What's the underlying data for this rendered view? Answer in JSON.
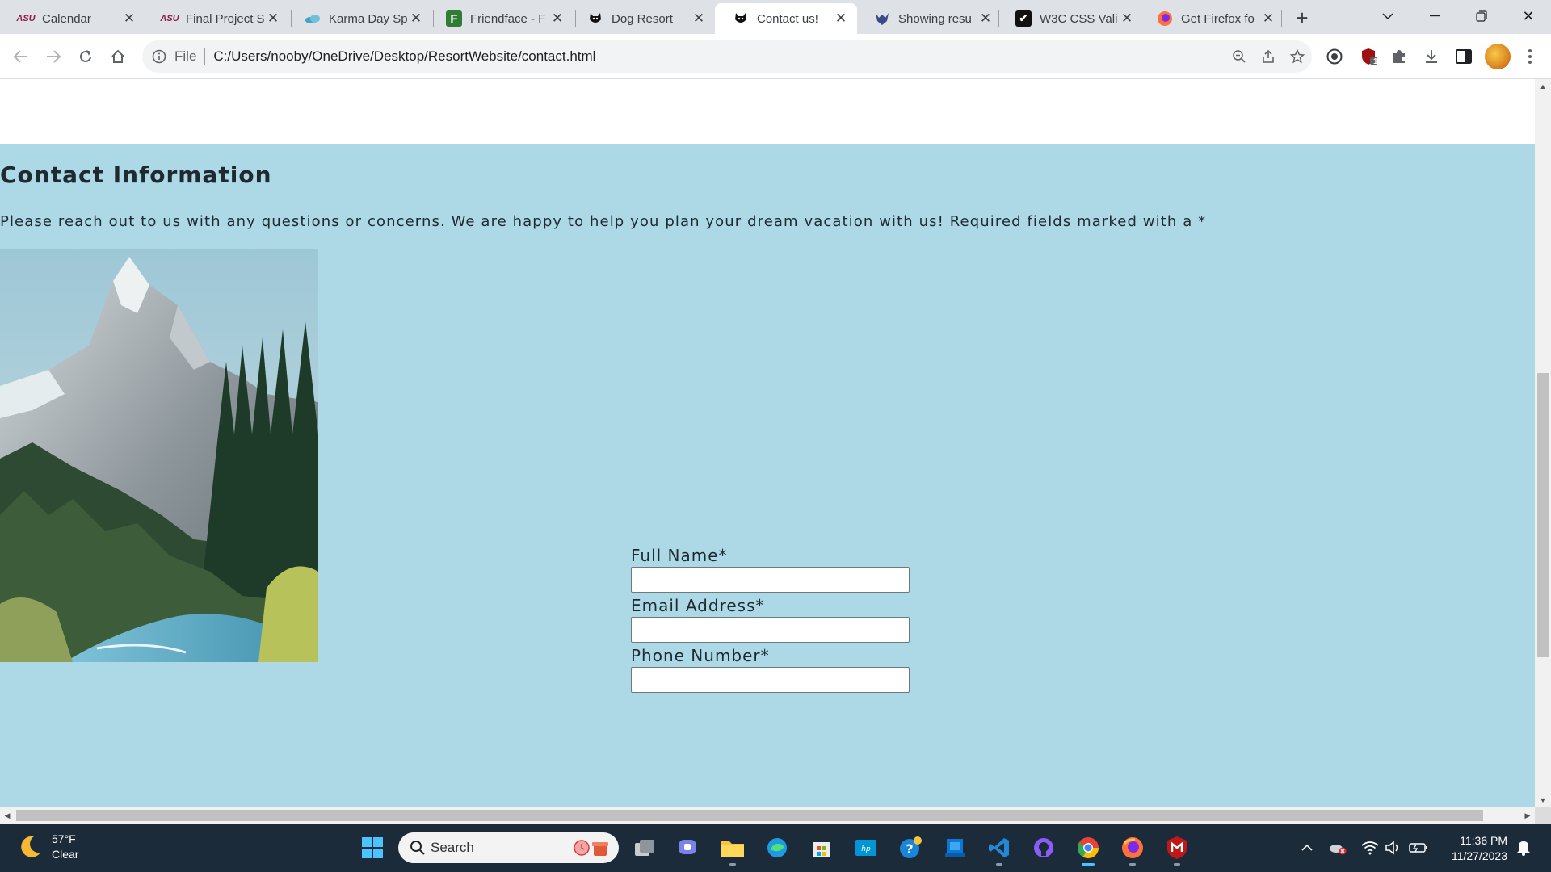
{
  "browser": {
    "tabs": [
      {
        "title": "Calendar",
        "favicon": "asu-logo-icon",
        "active": false
      },
      {
        "title": "Final Project S",
        "favicon": "asu-logo-icon",
        "active": false
      },
      {
        "title": "Karma Day Sp",
        "favicon": "cloud-icon",
        "active": false
      },
      {
        "title": "Friendface - F",
        "favicon": "friendface-icon",
        "active": false
      },
      {
        "title": "Dog Resort",
        "favicon": "dog-icon",
        "active": false
      },
      {
        "title": "Contact us!",
        "favicon": "dog-icon",
        "active": true
      },
      {
        "title": "Showing resu",
        "favicon": "elk-icon",
        "active": false
      },
      {
        "title": "W3C CSS Vali",
        "favicon": "w3c-icon",
        "active": false
      },
      {
        "title": "Get Firefox fo",
        "favicon": "firefox-icon",
        "active": false
      }
    ],
    "new_tab_label": "+",
    "address": {
      "scheme_label": "File",
      "url": "C:/Users/nooby/OneDrive/Desktop/ResortWebsite/contact.html"
    },
    "extension_badge": "1"
  },
  "page": {
    "heading": "Contact Information",
    "intro": "Please reach out to us with any questions or concerns. We are happy to help you plan your dream vacation with us! Required fields marked with a *",
    "image_alt": "mountain-landscape",
    "form": {
      "full_name_label": "Full Name*",
      "email_label": "Email Address*",
      "phone_label": "Phone Number*",
      "full_name_value": "",
      "email_value": "",
      "phone_value": ""
    },
    "background_color": "#add8e6"
  },
  "taskbar": {
    "weather": {
      "temp": "57°F",
      "condition": "Clear"
    },
    "search_label": "Search",
    "clock": {
      "time": "11:36 PM",
      "date": "11/27/2023"
    }
  }
}
